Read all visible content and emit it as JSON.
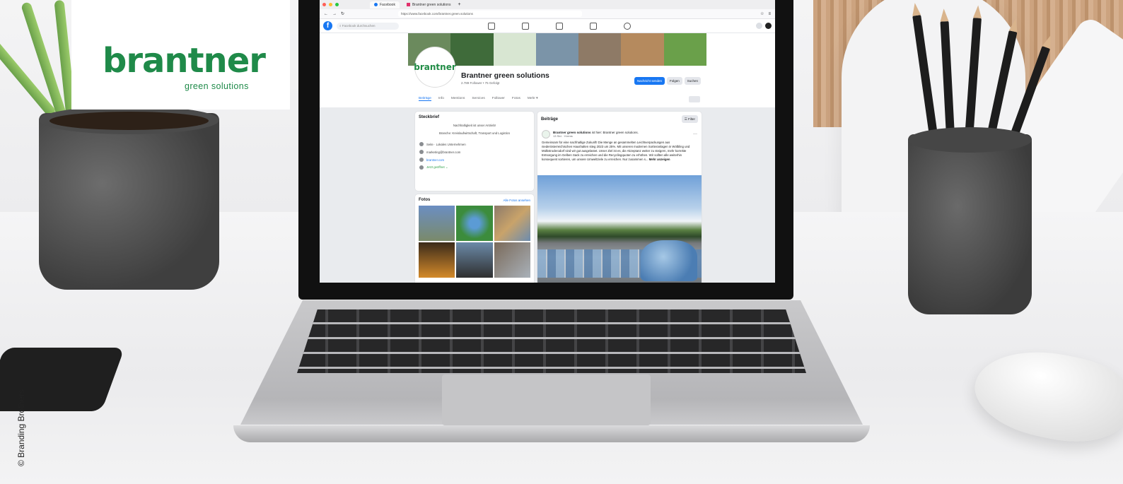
{
  "logo": {
    "wordmark": "brantner",
    "tagline": "green solutions",
    "color": "#1f8a49"
  },
  "credit": "© Branding Brothers",
  "browser": {
    "tabs": [
      {
        "label": "Facebook",
        "active": true
      },
      {
        "label": "Brantner green solutions",
        "active": false
      }
    ],
    "url": "https://www.facebook.com/brantner.green.solutions"
  },
  "facebook": {
    "search_placeholder": "Facebook durchsuchen",
    "brand_color": "#1877f2",
    "page": {
      "avatar_text": "brantner",
      "name": "Brantner green solutions",
      "meta": "2.789 Follower • 75 Gefolgt",
      "buttons": {
        "message": "Nachricht senden",
        "follow": "Folgen",
        "search": "Suchen"
      },
      "tabs": [
        "Beiträge",
        "Info",
        "Mentions",
        "Services",
        "Follower",
        "Fotos",
        "Mehr ▾"
      ]
    },
    "intro": {
      "title": "Steckbrief",
      "slogan": "Nachhaltigkeit ist unser Antrieb!",
      "industry": "Branche: Kreislaufwirtschaft, Transport und Logistics",
      "rows": [
        {
          "icon": "info-icon",
          "text": "Seite · Lokales Unternehmen"
        },
        {
          "icon": "mail-icon",
          "text": "marketing@brantner.com"
        },
        {
          "icon": "globe-icon",
          "text": "brantner.com"
        },
        {
          "icon": "clock-icon",
          "text": "Jetzt geöffnet ⌄"
        }
      ]
    },
    "photos": {
      "title": "Fotos",
      "link": "Alle Fotos ansehen"
    },
    "posts": {
      "title": "Beiträge",
      "filter": "Filter",
      "author": "Brantner green solutions",
      "author_suffix": "ist hier: Brantner green solutions.",
      "date": "13 Std. · Krems",
      "text": "Gemeinsam für eine nachhaltige Zukunft! Die Menge an gesammelten Leichtverpackungen aus niederösterreichischen Haushalten stieg 2023 um 25%. Mit unseren modernen Sortieranlagen in Wölbling und Mülkstroderodorf sind wir gut ausgelastet. Unser Ziel ist es, die Akzeptanz weiter zu steigern, mehr korrekte Entsorgung im Gelben Sack zu erreichen und die Recyclingquoten zu erhöhen. Wir sollten alle weiterhin konsequent sortieren, um unsere Umweltziele zu erreichen. Nur zusammen s...",
      "more": "Mehr anzeigen"
    }
  }
}
